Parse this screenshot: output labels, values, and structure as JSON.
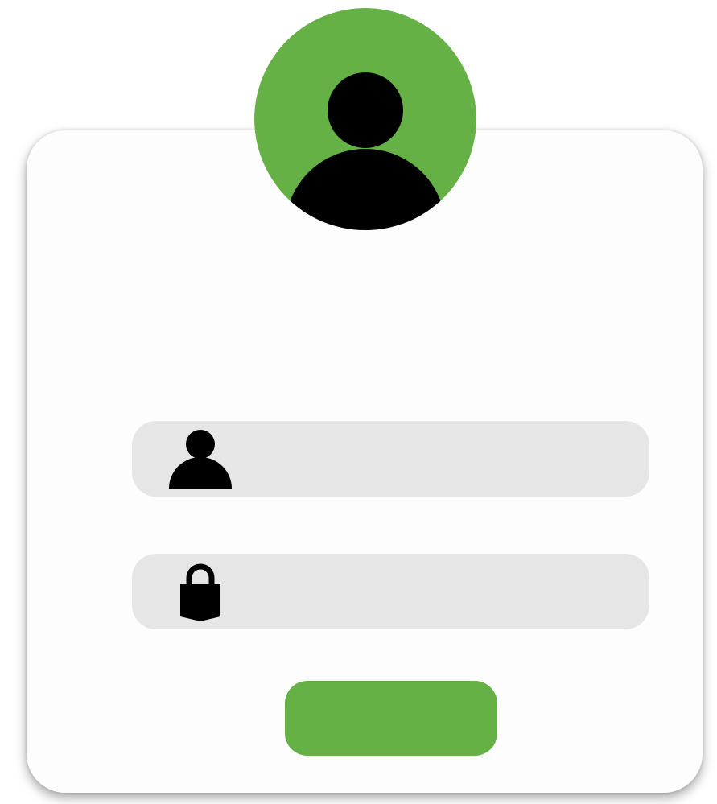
{
  "colors": {
    "accent": "#65b146",
    "field_bg": "#e6e6e6",
    "icon": "#000000",
    "card_bg": "#fdfdfd"
  },
  "avatar": {
    "icon": "user-silhouette-icon"
  },
  "username_field": {
    "icon": "user-icon",
    "value": "",
    "placeholder": ""
  },
  "password_field": {
    "icon": "lock-icon",
    "value": "",
    "placeholder": ""
  },
  "login_button": {
    "label": ""
  },
  "footer_links": {
    "left_label": "",
    "right_label": ""
  }
}
